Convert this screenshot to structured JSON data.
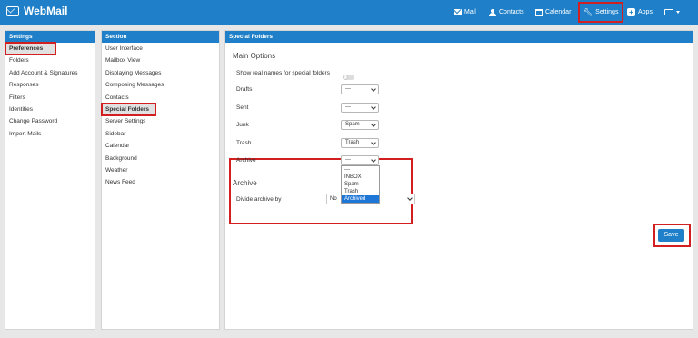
{
  "app": {
    "title": "WebMail"
  },
  "nav": {
    "mail": "Mail",
    "contacts": "Contacts",
    "calendar": "Calendar",
    "settings": "Settings",
    "apps": "Apps"
  },
  "settings_panel": {
    "title": "Settings",
    "items": [
      "Preferences",
      "Folders",
      "Add Account & Signatures",
      "Responses",
      "Filters",
      "Identities",
      "Change Password",
      "Import Mails"
    ]
  },
  "section_panel": {
    "title": "Section",
    "items": [
      "User Interface",
      "Mailbox View",
      "Displaying Messages",
      "Composing Messages",
      "Contacts",
      "Special Folders",
      "Server Settings",
      "Sidebar",
      "Calendar",
      "Background",
      "Weather",
      "News Feed"
    ]
  },
  "main": {
    "title": "Special Folders",
    "main_options": "Main Options",
    "show_real_names": "Show real names for special folders",
    "rows": [
      {
        "label": "Drafts",
        "value": "---"
      },
      {
        "label": "Sent",
        "value": "---"
      },
      {
        "label": "Junk",
        "value": "Spam"
      },
      {
        "label": "Trash",
        "value": "Trash"
      },
      {
        "label": "Archive",
        "value": "---"
      }
    ],
    "dropdown_options": [
      "---",
      "INBOX",
      "Spam",
      "Trash",
      "Archived"
    ],
    "dropdown_selected": "Archived",
    "archive_section": "Archive",
    "divide_label": "Divide archive by",
    "divide_value": "No",
    "save": "Save"
  }
}
